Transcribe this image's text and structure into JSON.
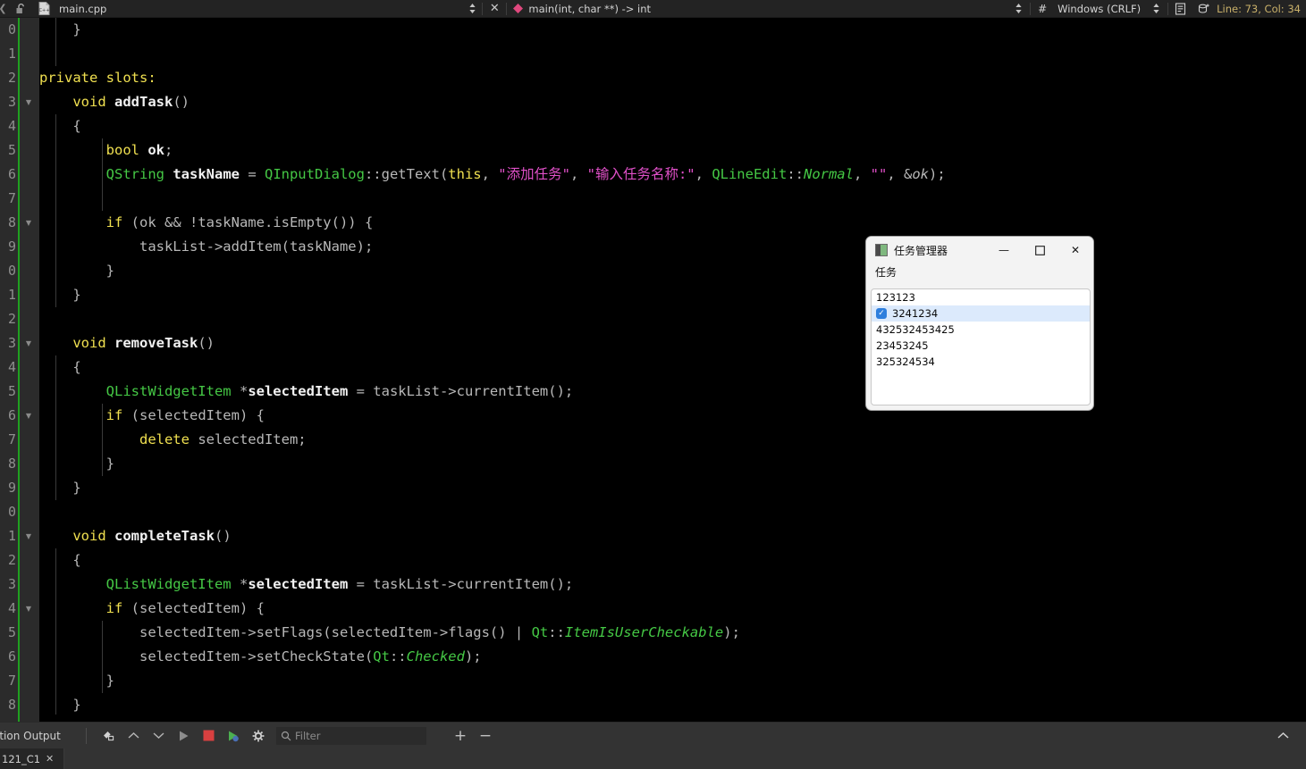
{
  "topbar": {
    "chevron_left_icon": "chevron-left",
    "lock_icon": "unlocked-padlock",
    "file_icon": "cpp-file",
    "filename": "main.cpp",
    "split_icon_1": "up-down-arrows",
    "close_icon": "✕",
    "symbol_marker_icon": "pink-diamond",
    "symbol_name": "main(int, char **) -> int",
    "split_icon_2": "up-down-arrows",
    "hash_icon": "#",
    "line_ending": "Windows (CRLF)",
    "split_icon_3": "up-down-arrows",
    "doc_icon": "document-lines",
    "db_icon": "database-plus",
    "cursor_position": "Line: 73, Col: 34"
  },
  "editor": {
    "line_numbers": [
      "0",
      "1",
      "2",
      "3",
      "4",
      "5",
      "6",
      "7",
      "8",
      "9",
      "0",
      "1",
      "2",
      "3",
      "4",
      "5",
      "6",
      "7",
      "8",
      "9",
      "0",
      "1",
      "2",
      "3",
      "4",
      "5",
      "6",
      "7",
      "8"
    ],
    "fold_rows": [
      3,
      8,
      13,
      16,
      21,
      24
    ],
    "lines": [
      [
        {
          "t": "    }",
          "c": "plain"
        }
      ],
      [],
      [
        {
          "t": "private slots:",
          "c": "kw"
        }
      ],
      [
        {
          "t": "    ",
          "c": "plain"
        },
        {
          "t": "void",
          "c": "kw"
        },
        {
          "t": " ",
          "c": "plain"
        },
        {
          "t": "addTask",
          "c": "fn"
        },
        {
          "t": "()",
          "c": "plain"
        }
      ],
      [
        {
          "t": "    {",
          "c": "plain"
        }
      ],
      [
        {
          "t": "        ",
          "c": "plain"
        },
        {
          "t": "bool",
          "c": "kw"
        },
        {
          "t": " ",
          "c": "plain"
        },
        {
          "t": "ok",
          "c": "var"
        },
        {
          "t": ";",
          "c": "plain"
        }
      ],
      [
        {
          "t": "        ",
          "c": "plain"
        },
        {
          "t": "QString",
          "c": "type"
        },
        {
          "t": " ",
          "c": "plain"
        },
        {
          "t": "taskName",
          "c": "var"
        },
        {
          "t": " = ",
          "c": "plain"
        },
        {
          "t": "QInputDialog",
          "c": "type"
        },
        {
          "t": "::getText(",
          "c": "plain"
        },
        {
          "t": "this",
          "c": "kw"
        },
        {
          "t": ", ",
          "c": "plain"
        },
        {
          "t": "\"添加任务\"",
          "c": "str"
        },
        {
          "t": ", ",
          "c": "plain"
        },
        {
          "t": "\"输入任务名称:\"",
          "c": "str"
        },
        {
          "t": ", ",
          "c": "plain"
        },
        {
          "t": "QLineEdit",
          "c": "type"
        },
        {
          "t": "::",
          "c": "plain"
        },
        {
          "t": "Normal",
          "c": "ital"
        },
        {
          "t": ", ",
          "c": "plain"
        },
        {
          "t": "\"\"",
          "c": "str"
        },
        {
          "t": ", &",
          "c": "plain"
        },
        {
          "t": "ok",
          "c": "italg"
        },
        {
          "t": ");",
          "c": "plain"
        }
      ],
      [],
      [
        {
          "t": "        ",
          "c": "plain"
        },
        {
          "t": "if",
          "c": "kw"
        },
        {
          "t": " (ok && !taskName.isEmpty()) {",
          "c": "plain"
        }
      ],
      [
        {
          "t": "            taskList->addItem(taskName);",
          "c": "plain"
        }
      ],
      [
        {
          "t": "        }",
          "c": "plain"
        }
      ],
      [
        {
          "t": "    }",
          "c": "plain"
        }
      ],
      [],
      [
        {
          "t": "    ",
          "c": "plain"
        },
        {
          "t": "void",
          "c": "kw"
        },
        {
          "t": " ",
          "c": "plain"
        },
        {
          "t": "removeTask",
          "c": "fn"
        },
        {
          "t": "()",
          "c": "plain"
        }
      ],
      [
        {
          "t": "    {",
          "c": "plain"
        }
      ],
      [
        {
          "t": "        ",
          "c": "plain"
        },
        {
          "t": "QListWidgetItem",
          "c": "type"
        },
        {
          "t": " *",
          "c": "plain"
        },
        {
          "t": "selectedItem",
          "c": "var"
        },
        {
          "t": " = taskList->currentItem();",
          "c": "plain"
        }
      ],
      [
        {
          "t": "        ",
          "c": "plain"
        },
        {
          "t": "if",
          "c": "kw"
        },
        {
          "t": " (selectedItem) {",
          "c": "plain"
        }
      ],
      [
        {
          "t": "            ",
          "c": "plain"
        },
        {
          "t": "delete",
          "c": "kw"
        },
        {
          "t": " selectedItem;",
          "c": "plain"
        }
      ],
      [
        {
          "t": "        }",
          "c": "plain"
        }
      ],
      [
        {
          "t": "    }",
          "c": "plain"
        }
      ],
      [],
      [
        {
          "t": "    ",
          "c": "plain"
        },
        {
          "t": "void",
          "c": "kw"
        },
        {
          "t": " ",
          "c": "plain"
        },
        {
          "t": "completeTask",
          "c": "fn"
        },
        {
          "t": "()",
          "c": "plain"
        }
      ],
      [
        {
          "t": "    {",
          "c": "plain"
        }
      ],
      [
        {
          "t": "        ",
          "c": "plain"
        },
        {
          "t": "QListWidgetItem",
          "c": "type"
        },
        {
          "t": " *",
          "c": "plain"
        },
        {
          "t": "selectedItem",
          "c": "var"
        },
        {
          "t": " = taskList->currentItem();",
          "c": "plain"
        }
      ],
      [
        {
          "t": "        ",
          "c": "plain"
        },
        {
          "t": "if",
          "c": "kw"
        },
        {
          "t": " (selectedItem) {",
          "c": "plain"
        }
      ],
      [
        {
          "t": "            selectedItem->setFlags(selectedItem->flags() | ",
          "c": "plain"
        },
        {
          "t": "Qt",
          "c": "type"
        },
        {
          "t": "::",
          "c": "plain"
        },
        {
          "t": "ItemIsUserCheckable",
          "c": "ital"
        },
        {
          "t": ");",
          "c": "plain"
        }
      ],
      [
        {
          "t": "            selectedItem->setCheckState(",
          "c": "plain"
        },
        {
          "t": "Qt",
          "c": "type"
        },
        {
          "t": "::",
          "c": "plain"
        },
        {
          "t": "Checked",
          "c": "ital"
        },
        {
          "t": ");",
          "c": "plain"
        }
      ],
      [
        {
          "t": "        }",
          "c": "plain"
        }
      ],
      [
        {
          "t": "    }",
          "c": "plain"
        }
      ]
    ]
  },
  "dialog": {
    "app_icon": "window-icon",
    "title": "任务管理器",
    "minimize_label": "—",
    "maximize_label": "☐",
    "close_label": "✕",
    "list_label": "任务",
    "items": [
      {
        "text": "123123",
        "checked": false,
        "selected": false
      },
      {
        "text": "3241234",
        "checked": true,
        "selected": true
      },
      {
        "text": "432532453425",
        "checked": false,
        "selected": false
      },
      {
        "text": "23453245",
        "checked": false,
        "selected": false
      },
      {
        "text": "325324534",
        "checked": false,
        "selected": false
      }
    ]
  },
  "output_toolbar": {
    "panel_label": "ation Output",
    "clear_icon": "clear-broom",
    "prev_icon": "chevron-up",
    "next_icon": "chevron-down",
    "run_icon": "play-triangle",
    "stop_icon": "stop-square",
    "debug_icon": "debug-run",
    "settings_icon": "gear",
    "search_icon": "magnifier",
    "filter_placeholder": "Filter",
    "zoom_in_label": "+",
    "zoom_out_label": "−",
    "collapse_icon": "chevron-up"
  },
  "bottom_tab": {
    "label": "121_C1",
    "close_label": "✕"
  },
  "colors": {
    "editor_bg": "#000000",
    "gutter_bg": "#2b2b2b",
    "modified_bar": "#20a020",
    "keyword": "#f0e050",
    "type": "#45c845",
    "string": "#e050c8",
    "accent_selection": "#dceafc",
    "checkbox": "#2f7fdd",
    "stop_red": "#d84040",
    "chrome_bg": "#333333"
  }
}
